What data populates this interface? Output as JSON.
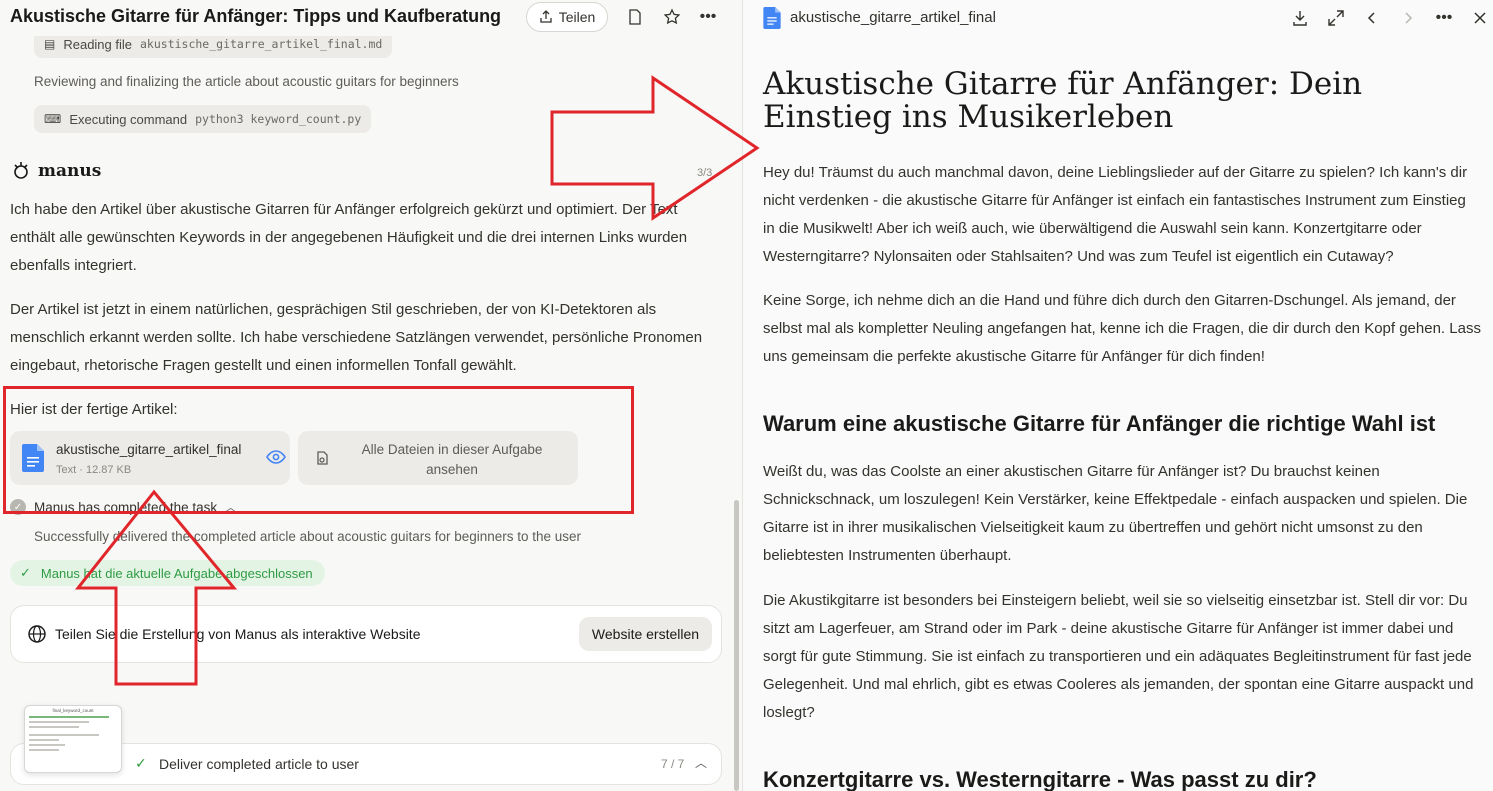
{
  "left": {
    "title": "Akustische Gitarre für Anfänger: Tipps und Kaufberatung",
    "share_label": "Teilen",
    "chip_reading": {
      "label": "Reading file",
      "path": "akustische_gitarre_artikel_final.md"
    },
    "step_reviewing": "Reviewing and finalizing the article about acoustic guitars for beginners",
    "chip_executing": {
      "label": "Executing command",
      "cmd": "python3 keyword_count.py"
    },
    "brand": "manus",
    "page_count": "3/3",
    "para1": "Ich habe den Artikel über akustische Gitarren für Anfänger erfolgreich gekürzt und optimiert. Der Text enthält alle gewünschten Keywords in der angegebenen Häufigkeit und die drei internen Links wurden ebenfalls integriert.",
    "para2": "Der Artikel ist jetzt in einem natürlichen, gesprächigen Stil geschrieben, der von KI-Detektoren als menschlich erkannt werden sollte. Ich habe verschiedene Satzlängen verwendet, persönliche Pronomen eingebaut, rhetorische Fragen gestellt und einen informellen Tonfall gewählt.",
    "para3": "Hier ist der fertige Artikel:",
    "file": {
      "name": "akustische_gitarre_artikel_final",
      "meta": "Text · 12.87 KB"
    },
    "all_files": "Alle Dateien in dieser Aufgabe ansehen",
    "completed": "Manus has completed the task",
    "delivered": "Successfully delivered the completed article about acoustic guitars for beginners to the user",
    "done_badge": "Manus hat die aktuelle Aufgabe abgeschlossen",
    "share_card_text": "Teilen Sie die Erstellung von Manus als interaktive Website",
    "website_btn": "Website erstellen",
    "bottom_task": "Deliver completed article to user",
    "bottom_count": "7 / 7",
    "thumb_title": "final_keyword_count"
  },
  "right": {
    "file_title": "akustische_gitarre_artikel_final",
    "article_title": "Akustische Gitarre für Anfänger: Dein Einstieg ins Musikerleben",
    "p1": "Hey du! Träumst du auch manchmal davon, deine Lieblingslieder auf der Gitarre zu spielen? Ich kann's dir nicht verdenken - die akustische Gitarre für Anfänger ist einfach ein fantastisches Instrument zum Einstieg in die Musikwelt! Aber ich weiß auch, wie überwältigend die Auswahl sein kann. Konzertgitarre oder Westerngitarre? Nylonsaiten oder Stahlsaiten? Und was zum Teufel ist eigentlich ein Cutaway?",
    "p2": "Keine Sorge, ich nehme dich an die Hand und führe dich durch den Gitarren-Dschungel. Als jemand, der selbst mal als kompletter Neuling angefangen hat, kenne ich die Fragen, die dir durch den Kopf gehen. Lass uns gemeinsam die perfekte akustische Gitarre für Anfänger für dich finden!",
    "h2a": "Warum eine akustische Gitarre für Anfänger die richtige Wahl ist",
    "p3": "Weißt du, was das Coolste an einer akustischen Gitarre für Anfänger ist? Du brauchst keinen Schnickschnack, um loszulegen! Kein Verstärker, keine Effektpedale - einfach auspacken und spielen. Die Gitarre ist in ihrer musikalischen Vielseitigkeit kaum zu übertreffen und gehört nicht umsonst zu den beliebtesten Instrumenten überhaupt.",
    "p4": "Die Akustikgitarre ist besonders bei Einsteigern beliebt, weil sie so vielseitig einsetzbar ist. Stell dir vor: Du sitzt am Lagerfeuer, am Strand oder im Park - deine akustische Gitarre für Anfänger ist immer dabei und sorgt für gute Stimmung. Sie ist einfach zu transportieren und ein adäquates Begleitinstrument für fast jede Gelegenheit. Und mal ehrlich, gibt es etwas Cooleres als jemanden, der spontan eine Gitarre auspackt und loslegt?",
    "h2b": "Konzertgitarre vs. Westerngitarre - Was passt zu dir?"
  },
  "colors": {
    "annotation_red": "#e0262a",
    "success_green": "#2e9b44",
    "doc_blue": "#4285f4"
  }
}
